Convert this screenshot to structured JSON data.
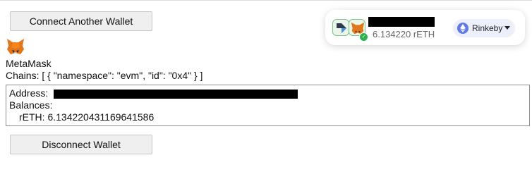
{
  "buttons": {
    "connect": "Connect Another Wallet",
    "disconnect": "Disconnect Wallet"
  },
  "wallet": {
    "name": "MetaMask",
    "chains_line": "Chains: [ { \"namespace\": \"evm\", \"id\": \"0x4\" } ]",
    "address_label": "Address:",
    "balances_label": "Balances:",
    "balance_line": "rETH: 6.134220431169641586"
  },
  "account_pill": {
    "balance": "6.134220 rETH",
    "network": "Rinkeby"
  },
  "colors": {
    "metamask_orange": "#e2761b",
    "network_bg": "#eef0f9",
    "ethereum_blue": "#6179e6",
    "connected_green": "#2bb24c"
  },
  "icons": [
    "metamask-fox-icon",
    "walletconnect-icon",
    "check-icon",
    "ethereum-icon",
    "caret-down-icon"
  ]
}
